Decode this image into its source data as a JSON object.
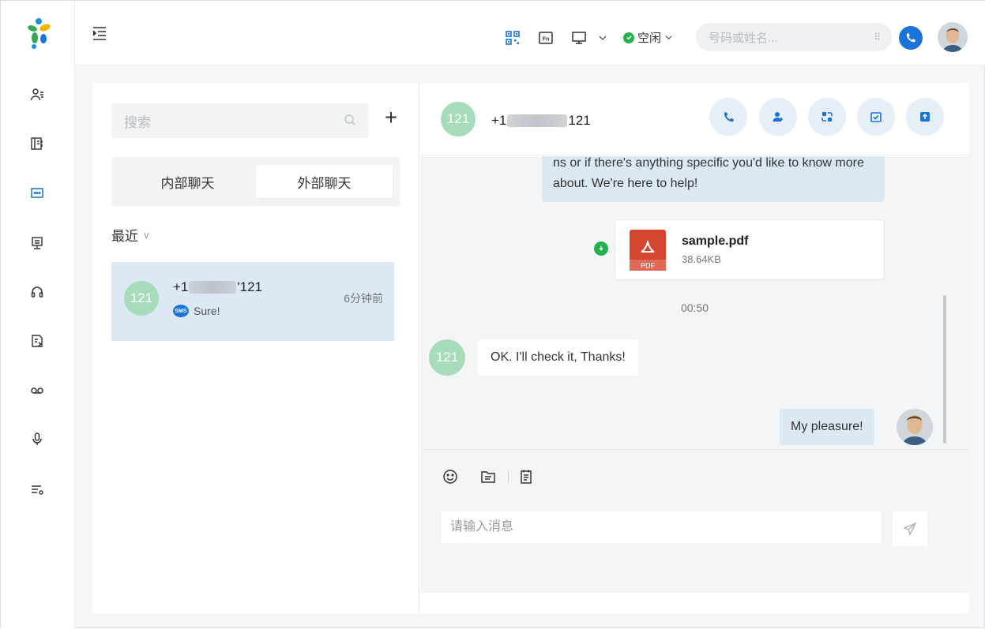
{
  "topbar": {
    "status_label": "空闲",
    "search_placeholder": "号码或姓名...",
    "dialpad_glyph": "⠿"
  },
  "sidebar": {
    "items": [
      {
        "icon": "contacts-icon"
      },
      {
        "icon": "phonebook-icon"
      },
      {
        "icon": "chat-icon"
      },
      {
        "icon": "monitor-icon"
      },
      {
        "icon": "headset-icon"
      },
      {
        "icon": "call-log-icon"
      },
      {
        "icon": "voicemail-icon"
      },
      {
        "icon": "microphone-icon"
      },
      {
        "icon": "settings-list-icon"
      }
    ]
  },
  "left": {
    "search_placeholder": "搜索",
    "add_label": "+",
    "tabs": [
      {
        "label": "内部聊天",
        "active": false
      },
      {
        "label": "外部聊天",
        "active": true
      }
    ],
    "recent_label": "最近",
    "recent_chevron": "∨",
    "conversation": {
      "avatar_text": "121",
      "number_prefix": "+1",
      "number_suffix": "'121",
      "time": "6分钟前",
      "preview": "Sure!",
      "badge": "SMS"
    }
  },
  "chat": {
    "avatar_text": "121",
    "number_prefix": "+1",
    "number_suffix": "121",
    "messages": {
      "top_partial": "ns or if there's anything specific you'd like to know more about. We're here to help!",
      "file_name": "sample.pdf",
      "file_size": "38.64KB",
      "file_type_label": "PDF",
      "timestamp": "00:50",
      "incoming_avatar": "121",
      "incoming": "OK. I'll check it, Thanks!",
      "outgoing": "My pleasure!"
    },
    "composer": {
      "placeholder": "请输入消息"
    }
  },
  "colors": {
    "accent": "#1a73d9",
    "status_green": "#22b14c",
    "avatar_green": "#a6dcb9",
    "selected_bg": "#dce8f4"
  }
}
